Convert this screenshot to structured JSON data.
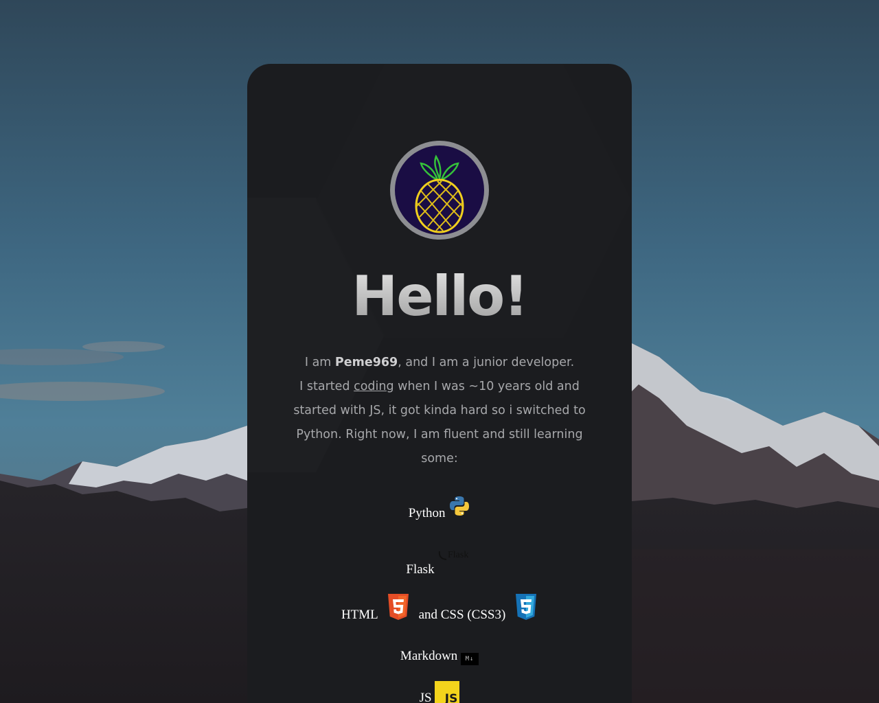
{
  "avatar": {
    "icon": "pineapple-icon",
    "ring_color": "#8d8e92",
    "bg_color": "#1a0d44"
  },
  "heading": {
    "text": "Hello!"
  },
  "intro": {
    "prefix": "I am ",
    "name": "Peme969",
    "line1_suffix": ", and I am a junior developer.",
    "line2_prefix": "I started ",
    "link_text": "coding",
    "rest": " when I was ~10 years old and started with JS, it got kinda hard so i switched to Python. Right now, I am fluent and still learning some:"
  },
  "skills": {
    "python": {
      "label": "Python",
      "icon": "python-icon"
    },
    "flask": {
      "label": "Flask",
      "icon_alt": "Flask",
      "icon": "flask-icon"
    },
    "html": {
      "label": "HTML",
      "icon": "html5-icon"
    },
    "css": {
      "label": "and CSS (CSS3)",
      "icon": "css3-icon"
    },
    "markdown": {
      "label": "Markdown",
      "icon": "markdown-icon",
      "badge_text": "M↓"
    },
    "js": {
      "label": "JS",
      "icon": "javascript-icon",
      "badge_text": "JS"
    }
  },
  "colors": {
    "card_bg": "#1b1c1f",
    "text": "#a7a8ab",
    "accent_yellow": "#f3d41c"
  }
}
